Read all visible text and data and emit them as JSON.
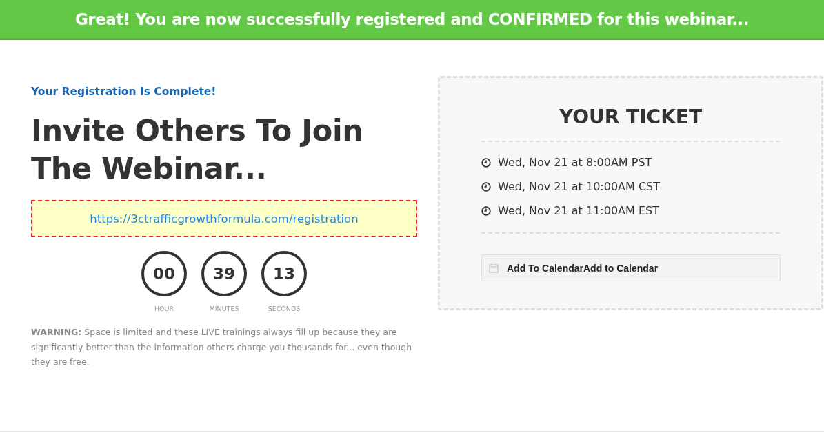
{
  "banner": {
    "text": "Great! You are now successfully registered and CONFIRMED for this webinar..."
  },
  "status": "Your Registration Is Complete!",
  "heading": "Invite Others To Join The Webinar...",
  "share_link": "https://3ctrafficgrowthformula.com/registration",
  "countdown": [
    {
      "value": "00",
      "unit": "HOUR"
    },
    {
      "value": "39",
      "unit": "MINUTES"
    },
    {
      "value": "13",
      "unit": "SECONDS"
    }
  ],
  "warning": "**WARNING:** Space is limited and these LIVE trainings always fill up because they are significantly better than the information others charge you thousands for... even though they are free.",
  "ticket": {
    "title": "YOUR TICKET",
    "times": [
      "Wed, Nov 21 at 8:00AM PST",
      "Wed, Nov 21 at 10:00AM CST",
      "Wed, Nov 21 at 11:00AM EST"
    ],
    "calendar_button": "Add To CalendarAdd to Calendar"
  }
}
